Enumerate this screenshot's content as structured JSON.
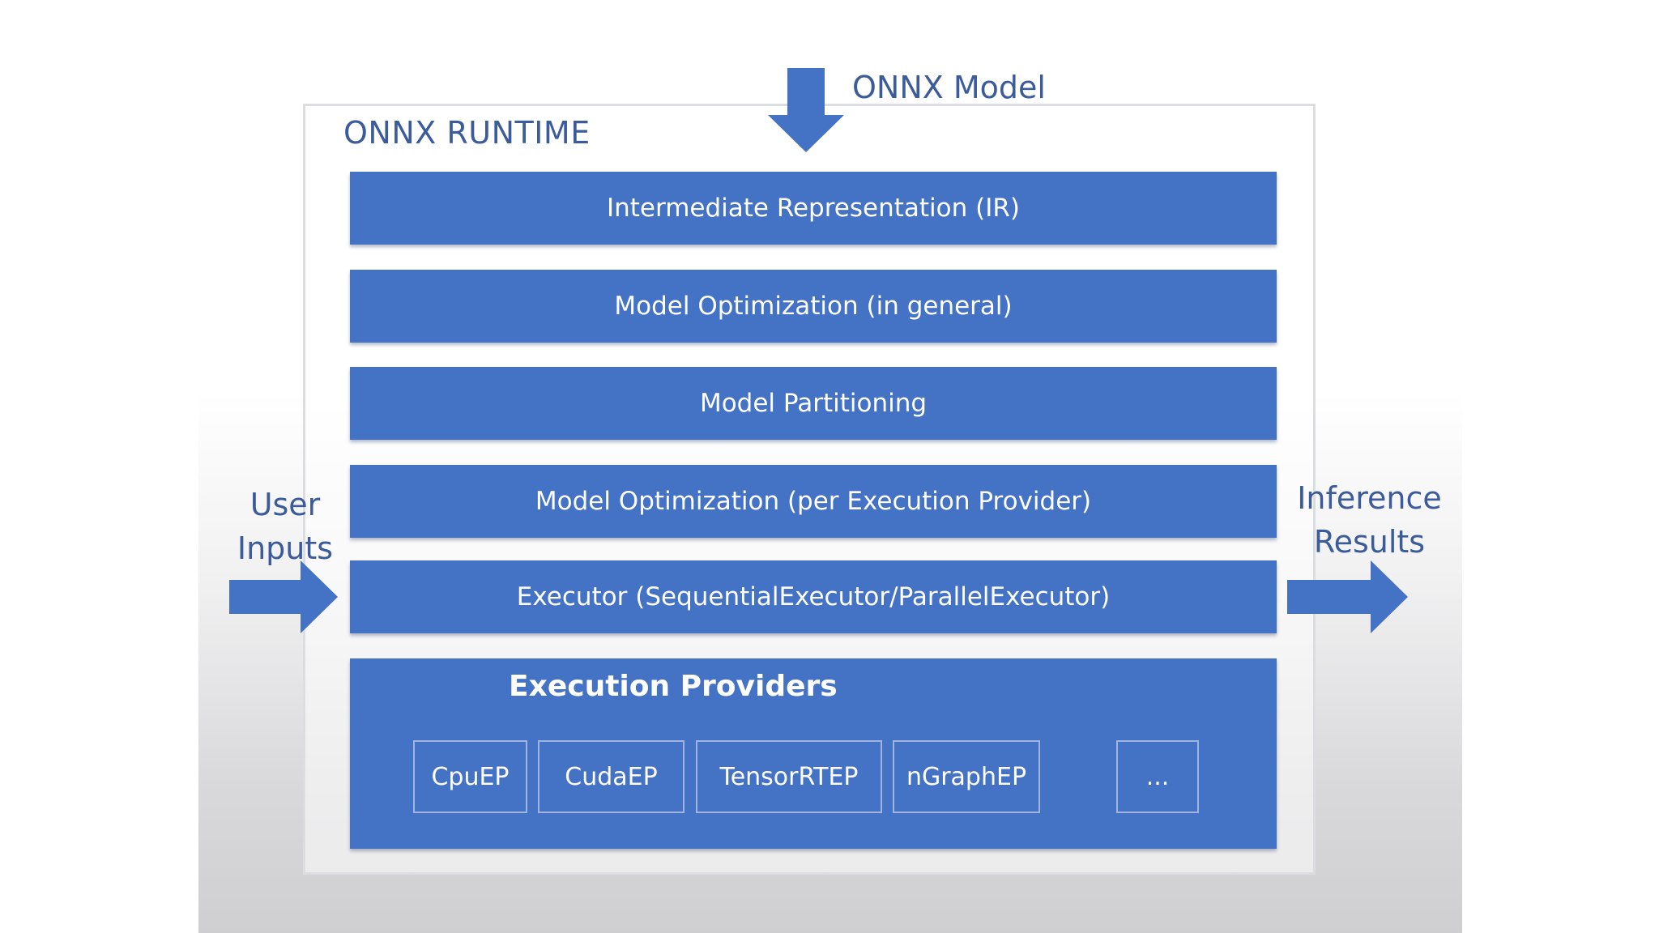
{
  "runtime": {
    "title": "ONNX RUNTIME"
  },
  "model_input": {
    "label": "ONNX Model",
    "arrow_icon": "arrow-down-icon"
  },
  "user_inputs": {
    "line1": "User",
    "line2": "Inputs",
    "arrow_icon": "arrow-right-icon"
  },
  "inference_results": {
    "line1": "Inference",
    "line2": "Results",
    "arrow_icon": "arrow-right-icon"
  },
  "layers": [
    {
      "label": "Intermediate Representation (IR)"
    },
    {
      "label": "Model Optimization (in general)"
    },
    {
      "label": "Model Partitioning"
    },
    {
      "label": "Model Optimization (per Execution Provider)"
    },
    {
      "label": "Executor (SequentialExecutor/ParallelExecutor)"
    }
  ],
  "execution_providers": {
    "title": "Execution Providers",
    "items": [
      {
        "label": "CpuEP"
      },
      {
        "label": "CudaEP"
      },
      {
        "label": "TensorRTEP"
      },
      {
        "label": "nGraphEP"
      },
      {
        "label": "..."
      }
    ]
  },
  "colors": {
    "block_blue": "#4472c4",
    "label_blue": "#3b5b9b",
    "ep_border": "#9fb4df"
  }
}
